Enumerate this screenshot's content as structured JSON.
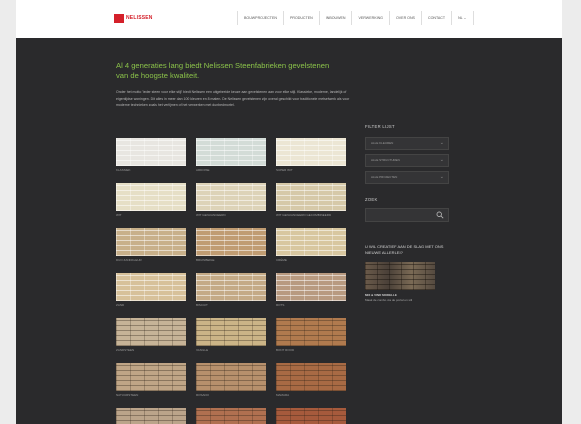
{
  "header": {
    "logo_text": "NELISSEN",
    "nav": [
      "Bouwprojecten",
      "Producten",
      "Inbouwen",
      "Verwerking",
      "Over ons",
      "Contact"
    ],
    "language": "NL ⌄"
  },
  "main": {
    "headline": "Al 4 generaties lang biedt Nelissen Steenfabrieken gevelstenen van de hoogste kwaliteit.",
    "intro": "Onder het motto 'ieder steen voor elke stijl' biedt Nelissen een uitgebreide keuze aan gevelstenen aan voor elke stijl. Klassieke, moderne, landelijk of eigentijdse woningen. Dit alles in meer dan 100 kleuren en 8 maten. De Nelissen gevelstenen zijn overal geschikt voor traditionele metselwerk als voor moderne technieken zoals het verlijmen of het verwerken met dunbedmortel."
  },
  "tiles": [
    {
      "label": "Klassiek",
      "color": "#e8e6e1"
    },
    {
      "label": "Ardoise",
      "color": "#d3dcd7"
    },
    {
      "label": "Super Wit",
      "color": "#ece6d4"
    },
    {
      "label": "Wit",
      "color": "#e6dfc6"
    },
    {
      "label": "Wit Genuanceerd",
      "color": "#ddd3b8"
    },
    {
      "label": "Wit Genuanceerd Gecombineerd",
      "color": "#d6c9a8"
    },
    {
      "label": "Duo Zandkleur",
      "color": "#c8b08a"
    },
    {
      "label": "Bruinbeige",
      "color": "#c09c72"
    },
    {
      "label": "Crème",
      "color": "#d8c7a0"
    },
    {
      "label": "Zand",
      "color": "#d7c19a"
    },
    {
      "label": "Biscuit",
      "color": "#c4aa86"
    },
    {
      "label": "Rots",
      "color": "#b89a80"
    },
    {
      "label": "Zandsteen",
      "color": "#c6b397"
    },
    {
      "label": "Vanille",
      "color": "#cbb487"
    },
    {
      "label": "Bont Rood",
      "color": "#b07a4e"
    },
    {
      "label": "Natuursteen",
      "color": "#bfa586"
    },
    {
      "label": "Rosado",
      "color": "#b7906c"
    },
    {
      "label": "Mamara",
      "color": "#a86a44"
    },
    {
      "label": "",
      "color": "#bba48a"
    },
    {
      "label": "",
      "color": "#b07050"
    },
    {
      "label": "",
      "color": "#a65a3c"
    }
  ],
  "sidebar": {
    "filter_title": "Filter lijst",
    "filters": [
      "Alle kleuren",
      "Alle structuren",
      "Alle projecten"
    ],
    "search_title": "Zoek",
    "search_value": "",
    "promo_title": "U wil creatief aan de slag met ons nieuwe allerlei?",
    "promo_caption": "Mix & Vind Modelle",
    "promo_sub": "Maak de combo via de portal en stil"
  }
}
